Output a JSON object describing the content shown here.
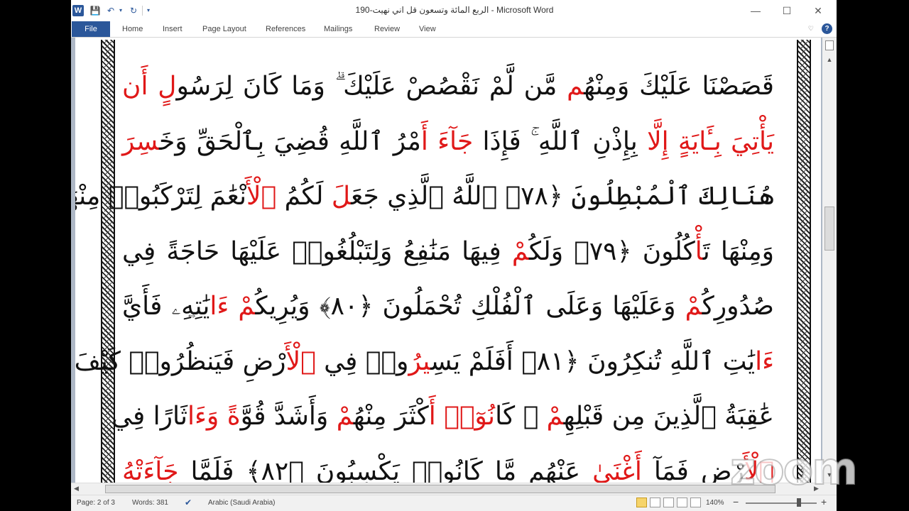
{
  "window": {
    "title": "الربع المائة وتسعون قل اني نهيت-190 - Microsoft Word",
    "controls": {
      "minimize": "—",
      "maximize": "☐",
      "close": "✕"
    }
  },
  "qat": {
    "word": "W",
    "save": "💾",
    "undo": "↶",
    "dropdown": "▾",
    "redo": "↻",
    "more": "▾"
  },
  "ribbon": {
    "file": "File",
    "tabs": [
      "Home",
      "Insert",
      "Page Layout",
      "References",
      "Mailings",
      "Review",
      "View"
    ],
    "minimize": "♡",
    "help": "?"
  },
  "document": {
    "lines": [
      [
        {
          "t": "قَصَصْنَا عَلَيْكَ وَمِنْهُ",
          "red": false
        },
        {
          "t": "م",
          "red": true
        },
        {
          "t": " مَّن لَّمْ نَقْصُصْ عَلَيْكَ ۗ وَمَا كَانَ لِرَسُو",
          "red": false
        },
        {
          "t": "لٍ أَن",
          "red": true
        }
      ],
      [
        {
          "t": "يَأْتِيَ بِـَٔايَةٍ إِلَّا",
          "red": true
        },
        {
          "t": " بِإِذْنِ ٱللَّهِ ۚ فَإِذَا ",
          "red": false
        },
        {
          "t": "جَآءَ أَ",
          "red": true
        },
        {
          "t": "مْرُ ٱللَّهِ قُضِيَ بِٱلْحَقِّ وَخَ",
          "red": false
        },
        {
          "t": "سِرَ",
          "red": true
        }
      ],
      [
        {
          "t": "هُنَالِكَ ٱلْمُبْطِلُونَ ﴿٧٨﴾ ٱللَّهُ ٱلَّذِي جَعَ",
          "red": false
        },
        {
          "t": "لَ",
          "red": true
        },
        {
          "t": " لَكُمُ ",
          "red": false
        },
        {
          "t": "ٱلْأَ",
          "red": true
        },
        {
          "t": "نْعَٰمَ لِتَرْكَبُوا۟ مِنْهَا",
          "red": false
        }
      ],
      [
        {
          "t": "وَمِنْهَا تَ",
          "red": false
        },
        {
          "t": "أْ",
          "red": true
        },
        {
          "t": "كُلُونَ ﴿٧٩﴾ وَلَكُ",
          "red": false
        },
        {
          "t": "مْ",
          "red": true
        },
        {
          "t": " فِيهَا مَنَٰفِعُ وَلِتَبْلُغُوا۟ عَلَيْهَا حَاجَةً فِي",
          "red": false
        }
      ],
      [
        {
          "t": "صُدُورِكُ",
          "red": false
        },
        {
          "t": "مْ",
          "red": true
        },
        {
          "t": " وَعَلَيْهَا وَعَلَى ٱلْفُلْكِ تُحْمَلُونَ ﴿٨٠﴾ وَيُرِيكُ",
          "red": false
        },
        {
          "t": "مْ ءَا",
          "red": true
        },
        {
          "t": "يَٰتِهِۦ فَأَيَّ",
          "red": false
        }
      ],
      [
        {
          "t": "ءَا",
          "red": true
        },
        {
          "t": "يَٰتِ ٱللَّهِ تُنكِرُونَ ﴿٨١﴾ أَفَلَمْ يَسِ",
          "red": false
        },
        {
          "t": "يرُ",
          "red": true
        },
        {
          "t": "وا۟ فِي ",
          "red": false
        },
        {
          "t": "ٱلْأَ",
          "red": true
        },
        {
          "t": "رْضِ فَيَنظُرُوا۟ كَيْفَ كَانَ",
          "red": false
        }
      ],
      [
        {
          "t": "عَٰقِبَةُ ٱلَّذِينَ مِن قَبْلِهِ",
          "red": false
        },
        {
          "t": "مْ",
          "red": true
        },
        {
          "t": " ۚ كَا",
          "red": false
        },
        {
          "t": "نُوٓا۟ أَ",
          "red": true
        },
        {
          "t": "كْثَرَ مِنْهُ",
          "red": false
        },
        {
          "t": "مْ",
          "red": true
        },
        {
          "t": " وَأَشَدَّ قُوَّ",
          "red": false
        },
        {
          "t": "ةً وَءَا",
          "red": true
        },
        {
          "t": "ثَارًا فِي",
          "red": false
        }
      ],
      [
        {
          "t": "ٱلْأَ",
          "red": true
        },
        {
          "t": "رْضِ فَمَآ ",
          "red": false
        },
        {
          "t": "أَغْنَىٰ",
          "red": true
        },
        {
          "t": " عَنْهُم مَّا كَانُوا۟ يَكْسِبُونَ ﴿٨٢﴾ فَلَمَّا ",
          "red": false
        },
        {
          "t": "جَآءَتْهُ",
          "red": true
        }
      ]
    ]
  },
  "statusbar": {
    "page": "Page: 2 of 3",
    "words": "Words: 381",
    "language": "Arabic (Saudi Arabia)",
    "zoom": "140%",
    "zoom_minus": "−",
    "zoom_plus": "+"
  },
  "overlay": {
    "zoom_watermark": "zoom"
  },
  "colors": {
    "accent": "#2b579a",
    "red_text": "#e01818"
  }
}
